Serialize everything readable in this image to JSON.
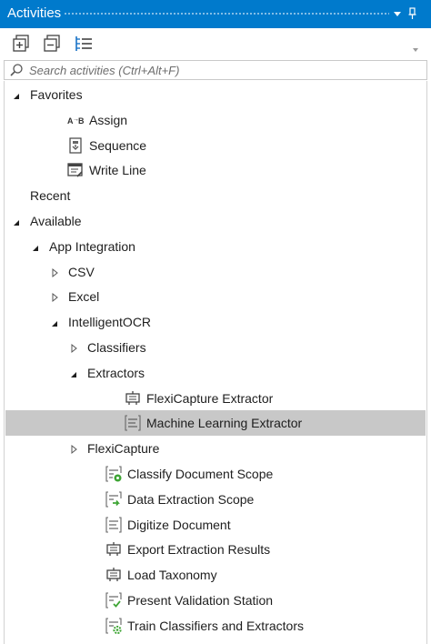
{
  "panel": {
    "title": "Activities",
    "pin_glyph": "📌",
    "dropdown_glyph": "▾"
  },
  "toolbar": {
    "buttons": [
      "expand-all-icon",
      "collapse-all-icon",
      "show-tree-icon"
    ]
  },
  "search": {
    "placeholder": "Search activities (Ctrl+Alt+F)",
    "value": ""
  },
  "tree": {
    "items": [
      {
        "label": "Favorites",
        "level": 0,
        "expander": "expanded",
        "icon": "none"
      },
      {
        "label": "Assign",
        "level": 1,
        "expander": "none",
        "icon": "assign-icon"
      },
      {
        "label": "Sequence",
        "level": 1,
        "expander": "none",
        "icon": "sequence-icon"
      },
      {
        "label": "Write Line",
        "level": 1,
        "expander": "none",
        "icon": "write-line-icon"
      },
      {
        "label": "Recent",
        "level": 0,
        "expander": "none",
        "icon": "none"
      },
      {
        "label": "Available",
        "level": 0,
        "expander": "expanded",
        "icon": "none"
      },
      {
        "label": "App Integration",
        "level": 1,
        "expander": "expanded",
        "icon": "none"
      },
      {
        "label": "CSV",
        "level": 2,
        "expander": "collapsed",
        "icon": "none"
      },
      {
        "label": "Excel",
        "level": 2,
        "expander": "collapsed",
        "icon": "none"
      },
      {
        "label": "IntelligentOCR",
        "level": 2,
        "expander": "expanded",
        "icon": "none"
      },
      {
        "label": "Classifiers",
        "level": 3,
        "expander": "collapsed",
        "icon": "none"
      },
      {
        "label": "Extractors",
        "level": 3,
        "expander": "expanded",
        "icon": "none"
      },
      {
        "label": "FlexiCapture Extractor",
        "level": 4,
        "expander": "none",
        "icon": "extractor-icon"
      },
      {
        "label": "Machine Learning Extractor",
        "level": 4,
        "expander": "none",
        "icon": "document-lines-icon",
        "selected": true
      },
      {
        "label": "FlexiCapture",
        "level": 3,
        "expander": "collapsed",
        "icon": "none"
      },
      {
        "label": "Classify Document Scope",
        "level": 3,
        "expander": "none",
        "icon": "classify-scope-icon"
      },
      {
        "label": "Data Extraction Scope",
        "level": 3,
        "expander": "none",
        "icon": "extraction-scope-icon"
      },
      {
        "label": "Digitize Document",
        "level": 3,
        "expander": "none",
        "icon": "document-lines-icon"
      },
      {
        "label": "Export Extraction Results",
        "level": 3,
        "expander": "none",
        "icon": "extractor-icon"
      },
      {
        "label": "Load Taxonomy",
        "level": 3,
        "expander": "none",
        "icon": "extractor-icon"
      },
      {
        "label": "Present Validation Station",
        "level": 3,
        "expander": "none",
        "icon": "validation-icon"
      },
      {
        "label": "Train Classifiers and Extractors",
        "level": 3,
        "expander": "none",
        "icon": "train-icon"
      }
    ]
  },
  "colors": {
    "titlebar": "#007acc",
    "selection": "#c8c8c8",
    "icon_green": "#3fa535"
  }
}
